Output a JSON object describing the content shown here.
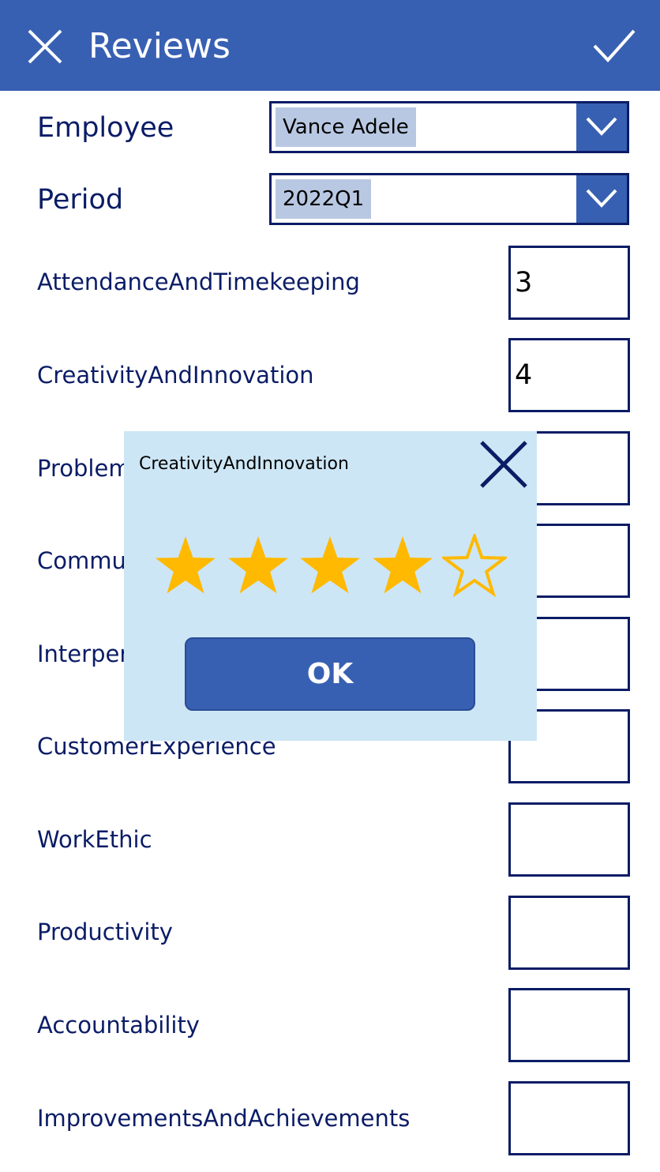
{
  "header": {
    "title": "Reviews",
    "background": "#3860b2"
  },
  "employee": {
    "label": "Employee",
    "value": "Vance Adele"
  },
  "period": {
    "label": "Period",
    "value": "2022Q1"
  },
  "rows": [
    {
      "label": "AttendanceAndTimekeeping",
      "value": "3"
    },
    {
      "label": "CreativityAndInnovation",
      "value": "4"
    },
    {
      "label": "ProblemSolving",
      "value": ""
    },
    {
      "label": "Communication",
      "value": ""
    },
    {
      "label": "InterpersonalSkills",
      "value": ""
    },
    {
      "label": "CustomerExperience",
      "value": ""
    },
    {
      "label": "WorkEthic",
      "value": ""
    },
    {
      "label": "Productivity",
      "value": ""
    },
    {
      "label": "Accountability",
      "value": ""
    },
    {
      "label": "ImprovementsAndAchievements",
      "value": ""
    }
  ],
  "popup": {
    "title": "CreativityAndInnovation",
    "rating": 4,
    "max_rating": 5,
    "ok_label": "OK",
    "background": "#cde6f5",
    "star_color": "#ffb900"
  },
  "icons": {
    "close": "close-icon",
    "confirm": "checkmark-icon",
    "dropdown": "chevron-down-icon",
    "star": "star-icon"
  },
  "colors": {
    "primary": "#3860b2",
    "text": "#0b1c66",
    "selection": "#b9c8e2"
  }
}
